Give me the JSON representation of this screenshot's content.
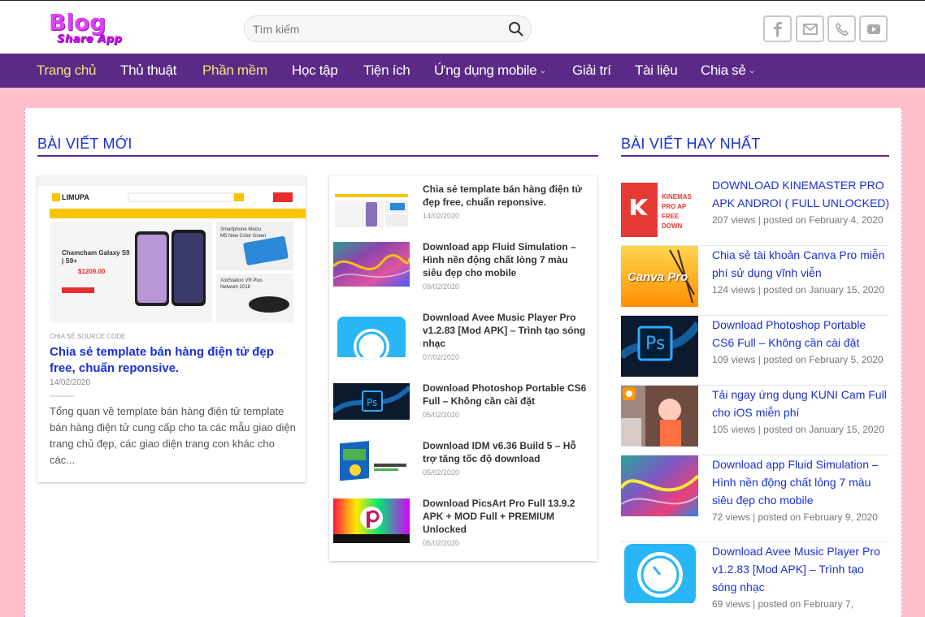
{
  "header": {
    "logo_line1": "Blog",
    "logo_line2": "Share App",
    "search_placeholder": "Tìm kiếm",
    "social_icons": [
      "facebook-icon",
      "mail-icon",
      "phone-icon",
      "youtube-icon"
    ]
  },
  "nav": {
    "items": [
      {
        "label": "Trang chủ"
      },
      {
        "label": "Thủ thuật"
      },
      {
        "label": "Phần mềm"
      },
      {
        "label": "Học tập"
      },
      {
        "label": "Tiện ích"
      },
      {
        "label": "Ứng dụng mobile"
      },
      {
        "label": "Giải trí"
      },
      {
        "label": "Tài liệu"
      },
      {
        "label": "Chia sẻ"
      }
    ]
  },
  "latest": {
    "title": "BÀI VIẾT MỚI",
    "featured": {
      "category": "CHIA SẺ SOURCE CODE",
      "title": "Chia sẻ template bán hàng điện tử đẹp free, chuẩn reponsive.",
      "date": "14/02/2020",
      "excerpt": "Tổng quan về template bán hàng điện tử template bán hàng điện tử cung cấp cho ta các mẫu giao diện trang chủ đẹp, các giao diện trang con khác cho các...",
      "thumb": {
        "brand": "LIMUPA",
        "promo1_title": "Chamcham Galaxy S9 | S9+",
        "promo1_price": "$1209.00",
        "promo2_title": "Smartphone Meizu M5 New Color Green",
        "promo3_title": "XoliStation VR Plus Network 2018"
      }
    },
    "items": [
      {
        "title": "Chia sẻ template bán hàng điện tử đẹp free, chuẩn reponsive.",
        "date": "14/02/2020"
      },
      {
        "title": "Download app Fluid Simulation – Hình nền động chất lỏng 7 màu siêu đẹp cho mobile",
        "date": "09/02/2020"
      },
      {
        "title": "Download Avee Music Player Pro v1.2.83 [Mod APK] – Trình tạo sóng nhạc",
        "date": "07/02/2020"
      },
      {
        "title": "Download Photoshop Portable CS6 Full – Không cần cài đặt",
        "date": "05/02/2020"
      },
      {
        "title": "Download IDM v6.36 Build 5 – Hỗ trợ tăng tốc độ download",
        "date": "05/02/2020"
      },
      {
        "title": "Download PicsArt Pro Full 13.9.2 APK + MOD Full + PREMIUM Unlocked",
        "date": "05/02/2020"
      }
    ]
  },
  "popular": {
    "title": "BÀI VIẾT HAY NHẤT",
    "items": [
      {
        "title": "DOWNLOAD KINEMASTER PRO APK ANDROI ( FULL UNLOCKED)",
        "meta": "207 views | posted on February 4, 2020",
        "thumb_text": "KINEMAS PRO AP FREE DOWN"
      },
      {
        "title": "Chia sẻ tài khoản Canva Pro miễn phí sử dụng vĩnh viễn",
        "meta": "124 views | posted on January 15, 2020",
        "thumb_text": "Canva Pro"
      },
      {
        "title": "Download Photoshop Portable CS6 Full – Không cần cài đặt",
        "meta": "109 views | posted on February 5, 2020",
        "thumb_text": "Ps"
      },
      {
        "title": "Tải ngay ứng dụng KUNI Cam Full cho iOS miễn phí",
        "meta": "105 views | posted on January 15, 2020",
        "thumb_text": ""
      },
      {
        "title": "Download app Fluid Simulation – Hình nền động chất lỏng 7 màu siêu đẹp cho mobile",
        "meta": "72 views | posted on February 9, 2020",
        "thumb_text": ""
      },
      {
        "title": "Download Avee Music Player Pro v1.2.83 [Mod APK] – Trình tạo sóng nhạc",
        "meta": "69 views | posted on February 7,",
        "thumb_text": ""
      }
    ]
  },
  "colors": {
    "nav_bg": "#5b2a86",
    "link": "#1a2fd6",
    "nav_active": "#f5e37a",
    "page_bg": "#ffc0cb"
  }
}
